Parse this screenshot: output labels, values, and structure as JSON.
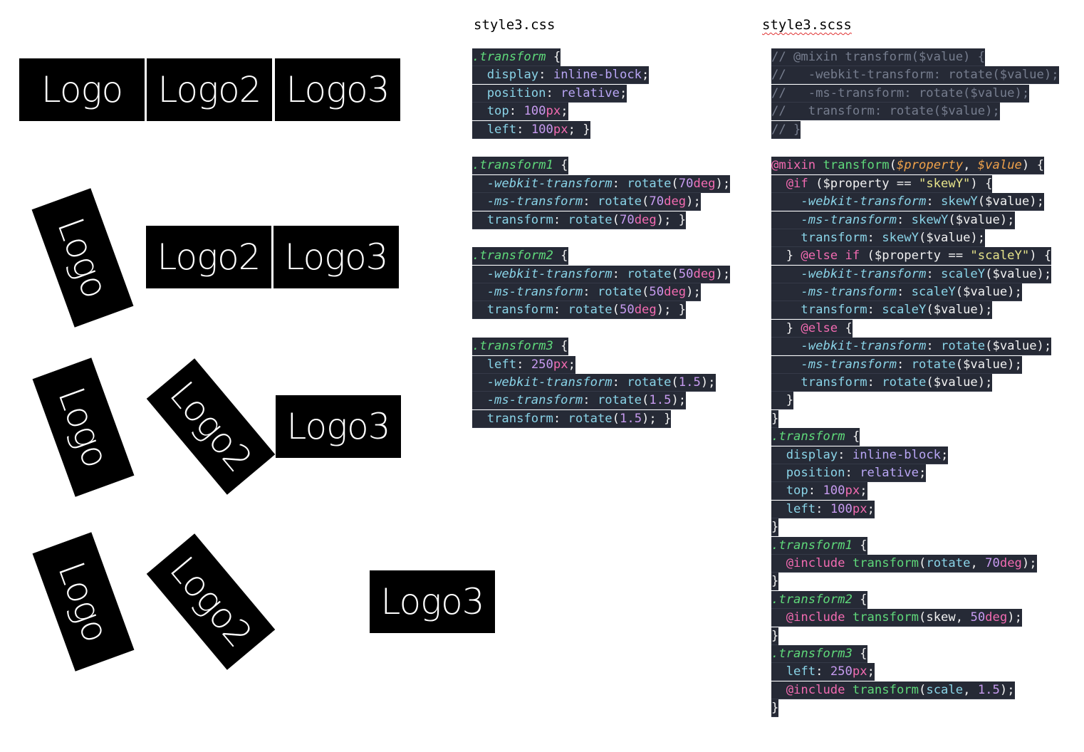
{
  "logos": {
    "logo1": "Logo",
    "logo2": "Logo2",
    "logo3": "Logo3"
  },
  "css_panel": {
    "title": "style3.css",
    "lines": [
      [
        [
          "t-sel",
          ".transform"
        ],
        [
          "t-brace",
          " {"
        ]
      ],
      [
        [
          "t-white",
          "  "
        ],
        [
          "t-prop",
          "display"
        ],
        [
          "t-punct",
          ": "
        ],
        [
          "t-val",
          "inline-block"
        ],
        [
          "t-punct",
          ";"
        ]
      ],
      [
        [
          "t-white",
          "  "
        ],
        [
          "t-prop",
          "position"
        ],
        [
          "t-punct",
          ": "
        ],
        [
          "t-val",
          "relative"
        ],
        [
          "t-punct",
          ";"
        ]
      ],
      [
        [
          "t-white",
          "  "
        ],
        [
          "t-prop",
          "top"
        ],
        [
          "t-punct",
          ": "
        ],
        [
          "t-num",
          "100"
        ],
        [
          "t-unit",
          "px"
        ],
        [
          "t-punct",
          ";"
        ]
      ],
      [
        [
          "t-white",
          "  "
        ],
        [
          "t-prop",
          "left"
        ],
        [
          "t-punct",
          ": "
        ],
        [
          "t-num",
          "100"
        ],
        [
          "t-unit",
          "px"
        ],
        [
          "t-punct",
          "; }"
        ]
      ],
      null,
      [
        [
          "t-sel",
          ".transform1"
        ],
        [
          "t-brace",
          " {"
        ]
      ],
      [
        [
          "t-white",
          "  "
        ],
        [
          "t-vprop",
          "-webkit-transform"
        ],
        [
          "t-punct",
          ": "
        ],
        [
          "t-fn",
          "rotate"
        ],
        [
          "t-punct",
          "("
        ],
        [
          "t-num",
          "70"
        ],
        [
          "t-unit",
          "deg"
        ],
        [
          "t-punct",
          ");"
        ]
      ],
      [
        [
          "t-white",
          "  "
        ],
        [
          "t-vprop",
          "-ms-transform"
        ],
        [
          "t-punct",
          ": "
        ],
        [
          "t-fn",
          "rotate"
        ],
        [
          "t-punct",
          "("
        ],
        [
          "t-num",
          "70"
        ],
        [
          "t-unit",
          "deg"
        ],
        [
          "t-punct",
          ");"
        ]
      ],
      [
        [
          "t-white",
          "  "
        ],
        [
          "t-prop",
          "transform"
        ],
        [
          "t-punct",
          ": "
        ],
        [
          "t-fn",
          "rotate"
        ],
        [
          "t-punct",
          "("
        ],
        [
          "t-num",
          "70"
        ],
        [
          "t-unit",
          "deg"
        ],
        [
          "t-punct",
          "); }"
        ]
      ],
      null,
      [
        [
          "t-sel",
          ".transform2"
        ],
        [
          "t-brace",
          " {"
        ]
      ],
      [
        [
          "t-white",
          "  "
        ],
        [
          "t-vprop",
          "-webkit-transform"
        ],
        [
          "t-punct",
          ": "
        ],
        [
          "t-fn",
          "rotate"
        ],
        [
          "t-punct",
          "("
        ],
        [
          "t-num",
          "50"
        ],
        [
          "t-unit",
          "deg"
        ],
        [
          "t-punct",
          ");"
        ]
      ],
      [
        [
          "t-white",
          "  "
        ],
        [
          "t-vprop",
          "-ms-transform"
        ],
        [
          "t-punct",
          ": "
        ],
        [
          "t-fn",
          "rotate"
        ],
        [
          "t-punct",
          "("
        ],
        [
          "t-num",
          "50"
        ],
        [
          "t-unit",
          "deg"
        ],
        [
          "t-punct",
          ");"
        ]
      ],
      [
        [
          "t-white",
          "  "
        ],
        [
          "t-prop",
          "transform"
        ],
        [
          "t-punct",
          ": "
        ],
        [
          "t-fn",
          "rotate"
        ],
        [
          "t-punct",
          "("
        ],
        [
          "t-num",
          "50"
        ],
        [
          "t-unit",
          "deg"
        ],
        [
          "t-punct",
          "); }"
        ]
      ],
      null,
      [
        [
          "t-sel",
          ".transform3"
        ],
        [
          "t-brace",
          " {"
        ]
      ],
      [
        [
          "t-white",
          "  "
        ],
        [
          "t-prop",
          "left"
        ],
        [
          "t-punct",
          ": "
        ],
        [
          "t-num",
          "250"
        ],
        [
          "t-unit",
          "px"
        ],
        [
          "t-punct",
          ";"
        ]
      ],
      [
        [
          "t-white",
          "  "
        ],
        [
          "t-vprop",
          "-webkit-transform"
        ],
        [
          "t-punct",
          ": "
        ],
        [
          "t-fn",
          "rotate"
        ],
        [
          "t-punct",
          "("
        ],
        [
          "t-num",
          "1.5"
        ],
        [
          "t-punct",
          ");"
        ]
      ],
      [
        [
          "t-white",
          "  "
        ],
        [
          "t-vprop",
          "-ms-transform"
        ],
        [
          "t-punct",
          ": "
        ],
        [
          "t-fn",
          "rotate"
        ],
        [
          "t-punct",
          "("
        ],
        [
          "t-num",
          "1.5"
        ],
        [
          "t-punct",
          ");"
        ]
      ],
      [
        [
          "t-white",
          "  "
        ],
        [
          "t-prop",
          "transform"
        ],
        [
          "t-punct",
          ": "
        ],
        [
          "t-fn",
          "rotate"
        ],
        [
          "t-punct",
          "("
        ],
        [
          "t-num",
          "1.5"
        ],
        [
          "t-punct",
          "); }"
        ]
      ]
    ]
  },
  "scss_panel": {
    "title": "style3.scss",
    "lines": [
      [
        [
          "t-comment",
          "// @mixin transform($value) {"
        ]
      ],
      [
        [
          "t-comment",
          "//   -webkit-transform: rotate($value);"
        ]
      ],
      [
        [
          "t-comment",
          "//   -ms-transform: rotate($value);"
        ]
      ],
      [
        [
          "t-comment",
          "//   transform: rotate($value);"
        ]
      ],
      [
        [
          "t-comment",
          "// }"
        ]
      ],
      null,
      [
        [
          "t-at",
          "@mixin"
        ],
        [
          "t-white",
          " "
        ],
        [
          "t-mixname",
          "transform"
        ],
        [
          "t-punct",
          "("
        ],
        [
          "t-param",
          "$property"
        ],
        [
          "t-punct",
          ", "
        ],
        [
          "t-param",
          "$value"
        ],
        [
          "t-punct",
          ") {"
        ]
      ],
      [
        [
          "t-white",
          "  "
        ],
        [
          "t-at",
          "@if"
        ],
        [
          "t-white",
          " ($property == "
        ],
        [
          "t-str",
          "\"skewY\""
        ],
        [
          "t-white",
          ") {"
        ]
      ],
      [
        [
          "t-white",
          "    "
        ],
        [
          "t-vprop",
          "-webkit-transform"
        ],
        [
          "t-punct",
          ": "
        ],
        [
          "t-fn",
          "skewY"
        ],
        [
          "t-white",
          "($value);"
        ]
      ],
      [
        [
          "t-white",
          "    "
        ],
        [
          "t-vprop",
          "-ms-transform"
        ],
        [
          "t-punct",
          ": "
        ],
        [
          "t-fn",
          "skewY"
        ],
        [
          "t-white",
          "($value);"
        ]
      ],
      [
        [
          "t-white",
          "    "
        ],
        [
          "t-prop",
          "transform"
        ],
        [
          "t-punct",
          ": "
        ],
        [
          "t-fn",
          "skewY"
        ],
        [
          "t-white",
          "($value);"
        ]
      ],
      [
        [
          "t-white",
          "  } "
        ],
        [
          "t-at",
          "@else if"
        ],
        [
          "t-white",
          " ($property == "
        ],
        [
          "t-str",
          "\"scaleY\""
        ],
        [
          "t-white",
          ") {"
        ]
      ],
      [
        [
          "t-white",
          "    "
        ],
        [
          "t-vprop",
          "-webkit-transform"
        ],
        [
          "t-punct",
          ": "
        ],
        [
          "t-fn",
          "scaleY"
        ],
        [
          "t-white",
          "($value);"
        ]
      ],
      [
        [
          "t-white",
          "    "
        ],
        [
          "t-vprop",
          "-ms-transform"
        ],
        [
          "t-punct",
          ": "
        ],
        [
          "t-fn",
          "scaleY"
        ],
        [
          "t-white",
          "($value);"
        ]
      ],
      [
        [
          "t-white",
          "    "
        ],
        [
          "t-prop",
          "transform"
        ],
        [
          "t-punct",
          ": "
        ],
        [
          "t-fn",
          "scaleY"
        ],
        [
          "t-white",
          "($value);"
        ]
      ],
      [
        [
          "t-white",
          "  } "
        ],
        [
          "t-at",
          "@else"
        ],
        [
          "t-white",
          " {"
        ]
      ],
      [
        [
          "t-white",
          "    "
        ],
        [
          "t-vprop",
          "-webkit-transform"
        ],
        [
          "t-punct",
          ": "
        ],
        [
          "t-fn",
          "rotate"
        ],
        [
          "t-white",
          "($value);"
        ]
      ],
      [
        [
          "t-white",
          "    "
        ],
        [
          "t-vprop",
          "-ms-transform"
        ],
        [
          "t-punct",
          ": "
        ],
        [
          "t-fn",
          "rotate"
        ],
        [
          "t-white",
          "($value);"
        ]
      ],
      [
        [
          "t-white",
          "    "
        ],
        [
          "t-prop",
          "transform"
        ],
        [
          "t-punct",
          ": "
        ],
        [
          "t-fn",
          "rotate"
        ],
        [
          "t-white",
          "($value);"
        ]
      ],
      [
        [
          "t-white",
          "  }"
        ]
      ],
      [
        [
          "t-white",
          "}"
        ]
      ],
      [
        [
          "t-sel",
          ".transform"
        ],
        [
          "t-brace",
          " {"
        ]
      ],
      [
        [
          "t-white",
          "  "
        ],
        [
          "t-prop",
          "display"
        ],
        [
          "t-punct",
          ": "
        ],
        [
          "t-val",
          "inline-block"
        ],
        [
          "t-punct",
          ";"
        ]
      ],
      [
        [
          "t-white",
          "  "
        ],
        [
          "t-prop",
          "position"
        ],
        [
          "t-punct",
          ": "
        ],
        [
          "t-val",
          "relative"
        ],
        [
          "t-punct",
          ";"
        ]
      ],
      [
        [
          "t-white",
          "  "
        ],
        [
          "t-prop",
          "top"
        ],
        [
          "t-punct",
          ": "
        ],
        [
          "t-num",
          "100"
        ],
        [
          "t-unit",
          "px"
        ],
        [
          "t-punct",
          ";"
        ]
      ],
      [
        [
          "t-white",
          "  "
        ],
        [
          "t-prop",
          "left"
        ],
        [
          "t-punct",
          ": "
        ],
        [
          "t-num",
          "100"
        ],
        [
          "t-unit",
          "px"
        ],
        [
          "t-punct",
          ";"
        ]
      ],
      [
        [
          "t-white",
          "}"
        ]
      ],
      [
        [
          "t-sel",
          ".transform1"
        ],
        [
          "t-brace",
          " {"
        ]
      ],
      [
        [
          "t-white",
          "  "
        ],
        [
          "t-at",
          "@include"
        ],
        [
          "t-white",
          " "
        ],
        [
          "t-mixname",
          "transform"
        ],
        [
          "t-punct",
          "("
        ],
        [
          "t-fn",
          "rotate"
        ],
        [
          "t-punct",
          ", "
        ],
        [
          "t-num",
          "70"
        ],
        [
          "t-unit",
          "deg"
        ],
        [
          "t-punct",
          ");"
        ]
      ],
      [
        [
          "t-white",
          "}"
        ]
      ],
      [
        [
          "t-sel",
          ".transform2"
        ],
        [
          "t-brace",
          " {"
        ]
      ],
      [
        [
          "t-white",
          "  "
        ],
        [
          "t-at",
          "@include"
        ],
        [
          "t-white",
          " "
        ],
        [
          "t-mixname",
          "transform"
        ],
        [
          "t-punct",
          "("
        ],
        [
          "t-white",
          "skew"
        ],
        [
          "t-punct",
          ", "
        ],
        [
          "t-num",
          "50"
        ],
        [
          "t-unit",
          "deg"
        ],
        [
          "t-punct",
          ");"
        ]
      ],
      [
        [
          "t-white",
          "}"
        ]
      ],
      [
        [
          "t-sel",
          ".transform3"
        ],
        [
          "t-brace",
          " {"
        ]
      ],
      [
        [
          "t-white",
          "  "
        ],
        [
          "t-prop",
          "left"
        ],
        [
          "t-punct",
          ": "
        ],
        [
          "t-num",
          "250"
        ],
        [
          "t-unit",
          "px"
        ],
        [
          "t-punct",
          ";"
        ]
      ],
      [
        [
          "t-white",
          "  "
        ],
        [
          "t-at",
          "@include"
        ],
        [
          "t-white",
          " "
        ],
        [
          "t-mixname",
          "transform"
        ],
        [
          "t-punct",
          "("
        ],
        [
          "t-fn",
          "scale"
        ],
        [
          "t-punct",
          ", "
        ],
        [
          "t-num",
          "1.5"
        ],
        [
          "t-punct",
          ");"
        ]
      ],
      [
        [
          "t-white",
          "}"
        ]
      ]
    ]
  }
}
